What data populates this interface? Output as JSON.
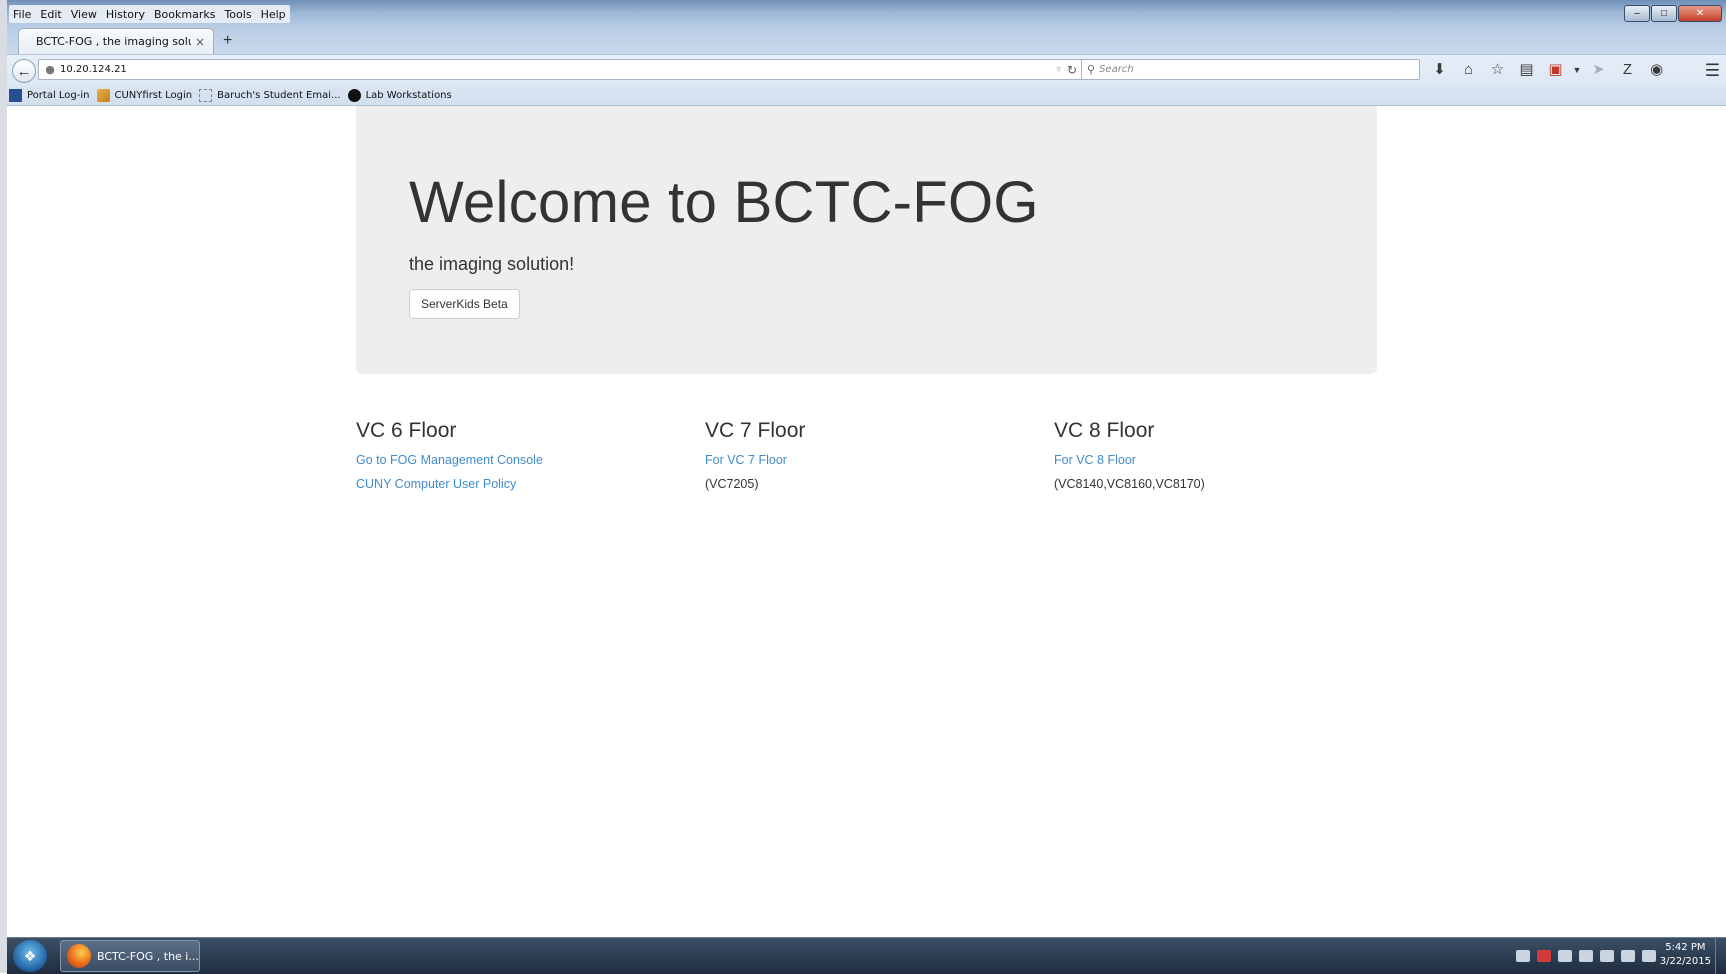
{
  "menu": [
    "File",
    "Edit",
    "View",
    "History",
    "Bookmarks",
    "Tools",
    "Help"
  ],
  "tab": {
    "title": "BCTC-FOG , the imaging soluti...",
    "close": "×",
    "new_tab": "+"
  },
  "window_controls": {
    "minimize": "–",
    "maximize": "□",
    "close": "✕"
  },
  "address": {
    "url": "10.20.124.21"
  },
  "search": {
    "placeholder": "Search"
  },
  "bookmarks": [
    {
      "label": "Portal Log-in",
      "icon": "portal-icon"
    },
    {
      "label": "CUNYfirst Login",
      "icon": "cuny-icon"
    },
    {
      "label": "Baruch's Student Emai...",
      "icon": "page-icon"
    },
    {
      "label": "Lab Workstations",
      "icon": "globe-icon"
    }
  ],
  "jumbotron": {
    "heading": "Welcome to BCTC-FOG",
    "subheading": "the imaging solution!",
    "button": "ServerKids Beta"
  },
  "columns": [
    {
      "title": "VC 6 Floor",
      "link1": "Go to FOG Management Console",
      "link2": "CUNY Computer User Policy"
    },
    {
      "title": "VC 7 Floor",
      "link1": "For VC 7 Floor",
      "note": "(VC7205)"
    },
    {
      "title": "VC 8 Floor",
      "link1": "For VC 8 Floor",
      "note": "(VC8140,VC8160,VC8170)"
    }
  ],
  "taskbar": {
    "item": "BCTC-FOG , the i...",
    "time": "5:42 PM",
    "date": "3/22/2015"
  },
  "colors": {
    "link": "#428bca",
    "jumbotron_bg": "#eeeeee",
    "text": "#333333"
  }
}
